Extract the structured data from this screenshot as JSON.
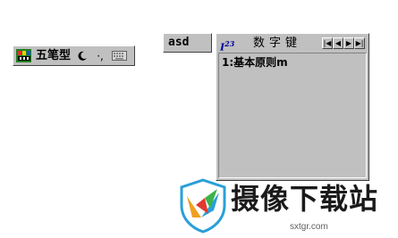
{
  "ime_status": {
    "mode_label": "五笔型",
    "punct_label": "·,",
    "icons": [
      "ime-logo-icon",
      "half-moon-icon",
      "punctuation-icon",
      "keyboard-icon"
    ]
  },
  "composition": {
    "text": "asd"
  },
  "candidate": {
    "badge": "I",
    "badge_sup": "23",
    "title": "数字键",
    "pager_icons": [
      "first-page-icon",
      "prev-page-icon",
      "next-page-icon",
      "last-page-icon"
    ],
    "pager_glyphs": [
      "|◀",
      "◀",
      "▶",
      "▶|"
    ],
    "items": [
      "1:基本原则m"
    ]
  },
  "watermark": {
    "brand": "摄像下载站",
    "domain": "sxtgr.com"
  },
  "colors": {
    "face": "#c0c0c0",
    "highlight": "#ffffff",
    "shadow": "#404040",
    "badge": "#0000a0"
  }
}
